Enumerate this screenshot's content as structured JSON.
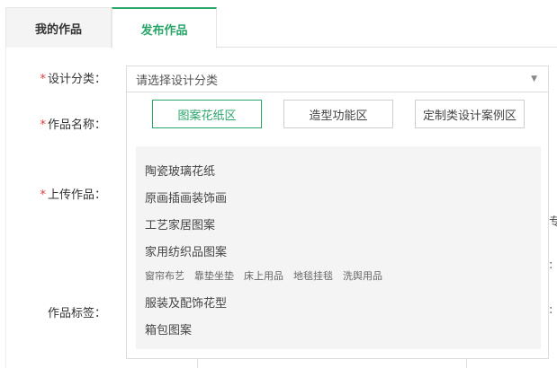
{
  "tabs": [
    {
      "label": "我的作品"
    },
    {
      "label": "发布作品"
    }
  ],
  "form": {
    "required_mark": "*",
    "design_category_label": "设计分类：",
    "work_name_label": "作品名称：",
    "upload_label": "上传作品：",
    "tags_label": "作品标签：",
    "select_placeholder": "请选择设计分类",
    "select_arrow": "▼"
  },
  "dropdown": {
    "buttons": [
      {
        "label": "图案花纸区",
        "active": true
      },
      {
        "label": "造型功能区",
        "active": false
      },
      {
        "label": "定制类设计案例区",
        "active": false
      }
    ],
    "items": [
      "陶瓷玻璃花纸",
      "原画插画装饰画",
      "工艺家居图案",
      "家用纺织品图案",
      "服装及配饰花型",
      "箱包图案"
    ],
    "subitems": [
      "窗帘布艺",
      "靠垫坐垫",
      "床上用品",
      "地毯挂毯",
      "洗舆用品"
    ]
  },
  "fragments": {
    "right_upload": "专",
    "right_colon1": ":",
    "right_colon2": ":"
  },
  "colors": {
    "accent": "#29a56a",
    "required": "#e4393c"
  }
}
